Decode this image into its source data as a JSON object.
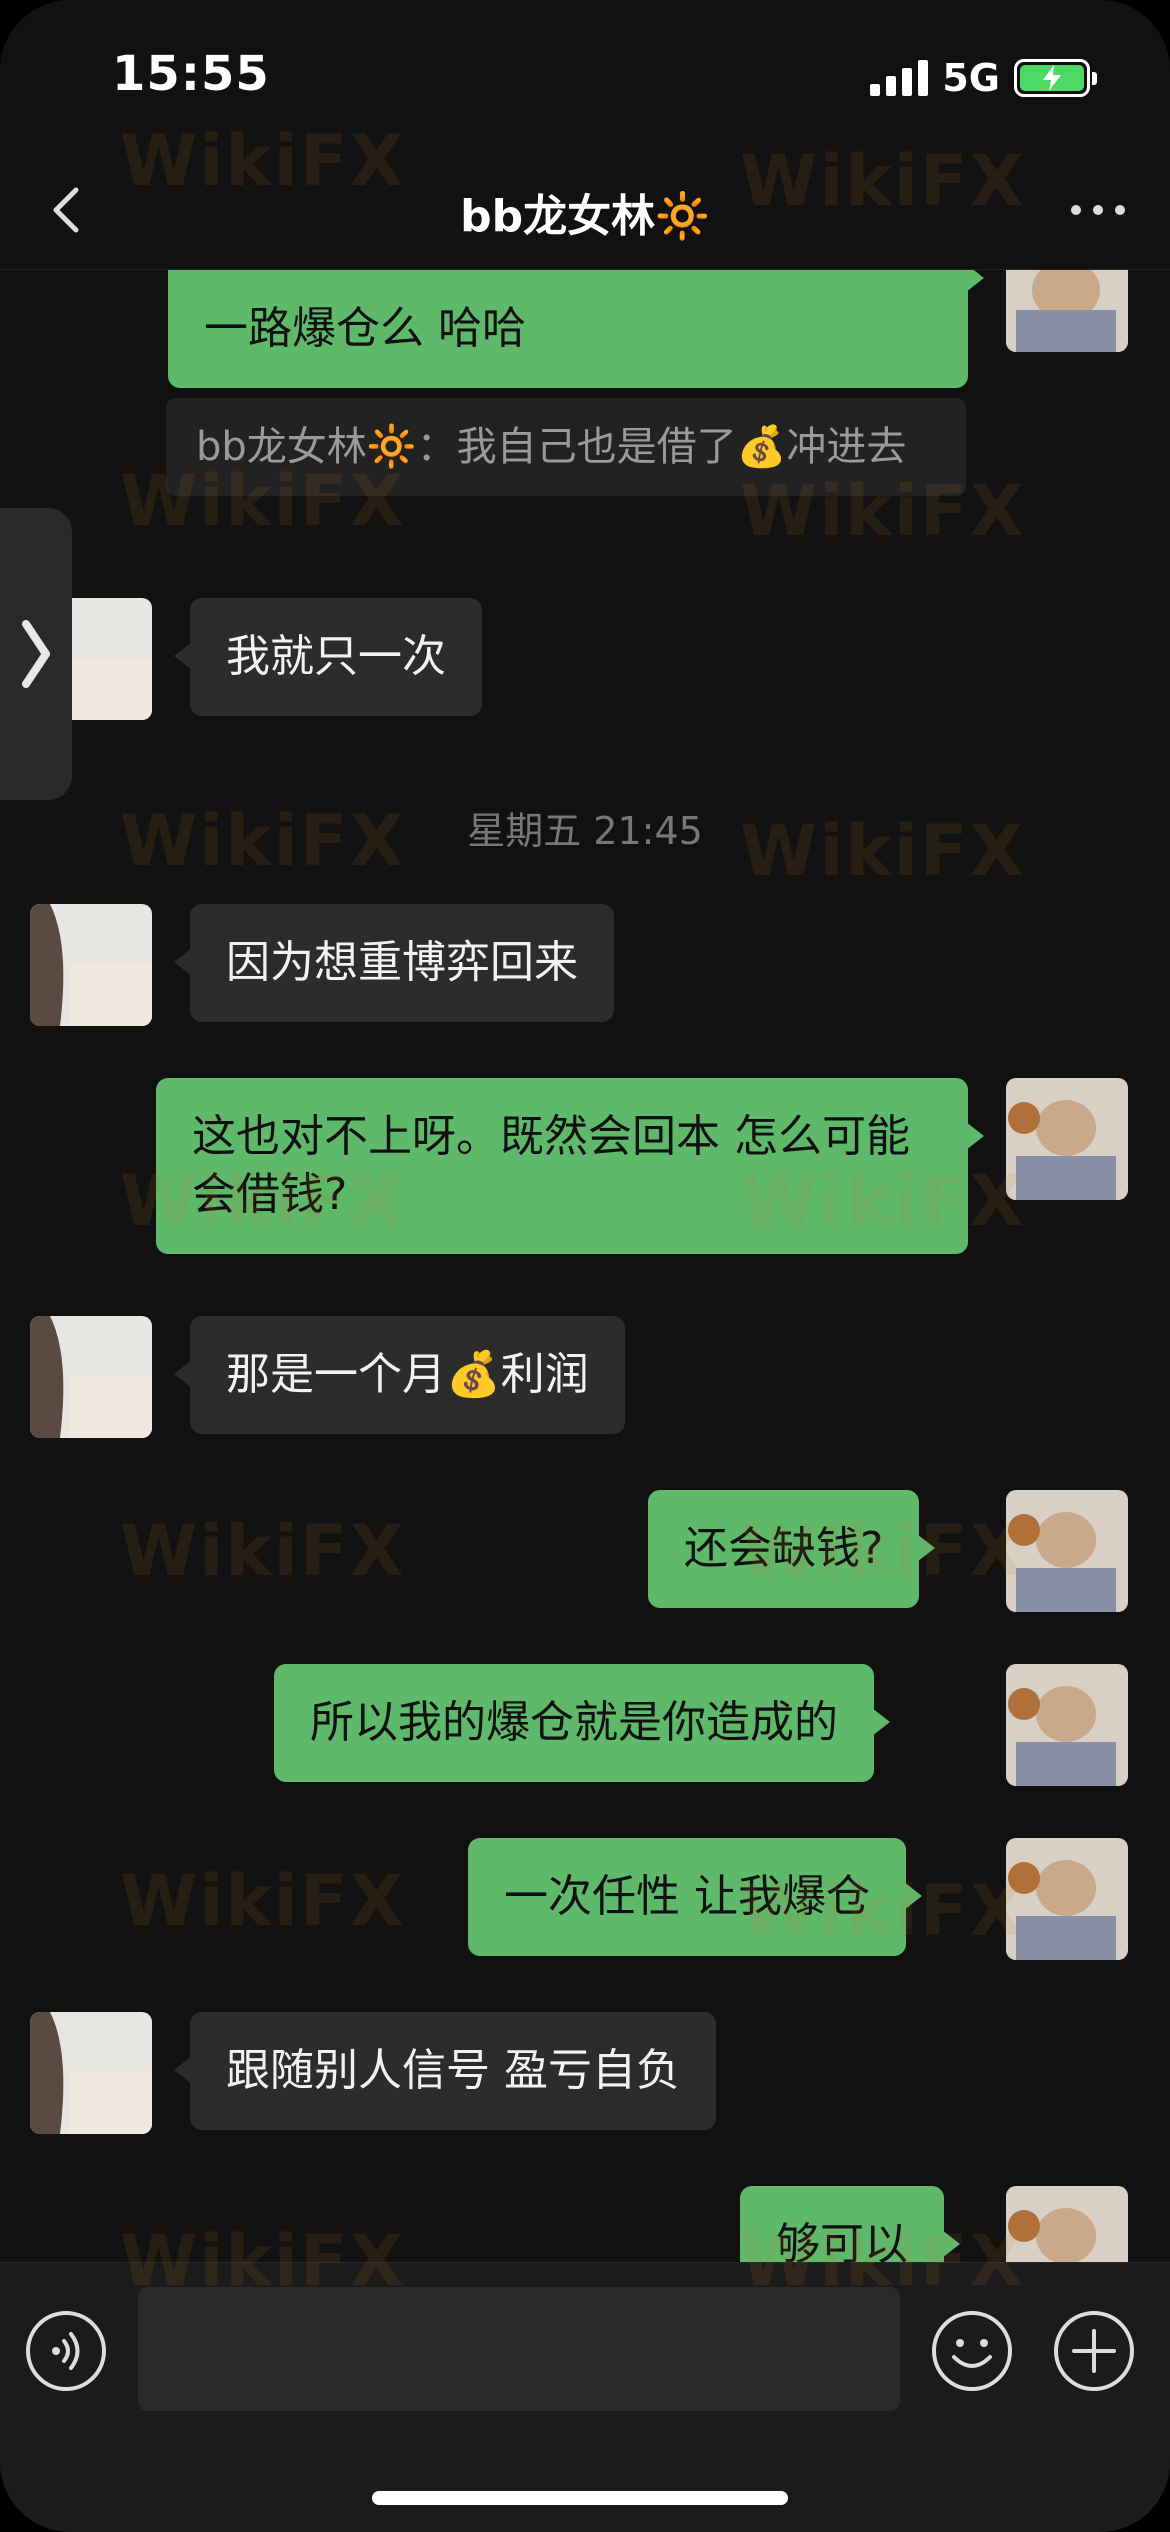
{
  "status": {
    "time": "15:55",
    "network": "5G"
  },
  "nav": {
    "title": "bb龙女林🔆"
  },
  "messages": {
    "m0": "一路爆仓么 哈哈",
    "quote": "bb龙女林🔆：我自己也是借了💰冲进去",
    "m1": "我就只一次",
    "timestamp": "星期五 21:45",
    "m2": "因为想重博弈回来",
    "m3": "这也对不上呀。既然会回本 怎么可能会借钱?",
    "m4": "那是一个月💰利润",
    "m5": "还会缺钱?",
    "m6": "所以我的爆仓就是你造成的",
    "m7": "一次任性 让我爆仓",
    "m8": "跟随别人信号 盈亏自负",
    "m9": "够可以"
  },
  "watermark": "WikiFX",
  "input": {
    "placeholder": ""
  },
  "colors": {
    "outgoing_bubble": "#5fb96b",
    "incoming_bubble": "#2c2c2c",
    "background": "#111111"
  },
  "icons": [
    "back-icon",
    "more-icon",
    "expand-chevron-icon",
    "voice-icon",
    "emoji-icon",
    "plus-icon",
    "signal-icon",
    "battery-icon"
  ]
}
